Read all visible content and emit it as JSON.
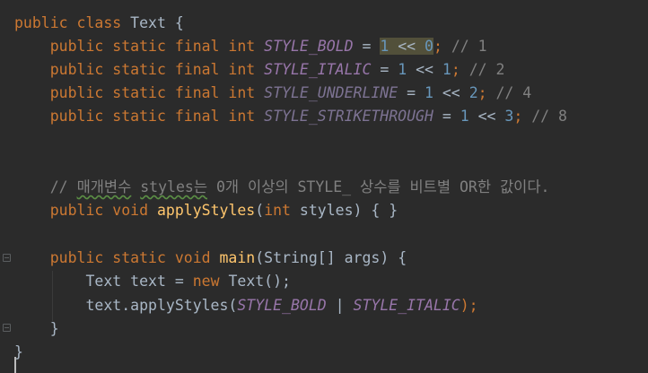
{
  "code": {
    "l1": {
      "kw": "public class",
      "name": " Text {"
    },
    "l2": {
      "mods": "public static final int",
      "const": "STYLE_BOLD",
      "eq": " = ",
      "a": "1",
      "op": " << ",
      "b": "0",
      "semi": ";",
      "cmt": " // 1"
    },
    "l3": {
      "mods": "public static final int",
      "const": "STYLE_ITALIC",
      "eq": " = ",
      "a": "1",
      "op": " << ",
      "b": "1",
      "semi": ";",
      "cmt": " // 2"
    },
    "l4": {
      "mods": "public static final int",
      "const": "STYLE_UNDERLINE",
      "eq": " = ",
      "a": "1",
      "op": " << ",
      "b": "2",
      "semi": ";",
      "cmt": " // 4"
    },
    "l5": {
      "mods": "public static final int",
      "const": "STYLE_STRIKETHROUGH",
      "eq": " = ",
      "a": "1",
      "op": " << ",
      "b": "3",
      "semi": ";",
      "cmt": " // 8"
    },
    "l8": {
      "pre": "// ",
      "w1": "매개변수",
      "sp": " ",
      "w2": "styles는",
      "rest": " 0개 이상의 STYLE_ 상수를 비트별 OR한 값이다."
    },
    "l9": {
      "kw": "public void",
      "fn": "applyStyles",
      "open": "(",
      "kw2": "int",
      "param": " styles",
      "close": ") { }"
    },
    "l11": {
      "kw": "public static void",
      "fn": "main",
      "rest": "(String[] args) {"
    },
    "l12": {
      "type": "Text text = ",
      "kw": "new",
      "rest": " Text();"
    },
    "l13": {
      "pre": "text.applyStyles(",
      "c1": "STYLE_BOLD",
      "pipe": " | ",
      "c2": "STYLE_ITALIC",
      "post": ");"
    },
    "l14": {
      "text": "}"
    },
    "l15": {
      "text": "}"
    }
  },
  "colors": {
    "background": "#2b2b2b",
    "keyword": "#cc7832",
    "constant": "#9876aa",
    "number": "#6897bb",
    "comment": "#808080",
    "function": "#ffc66d",
    "text": "#a9b7c6"
  }
}
